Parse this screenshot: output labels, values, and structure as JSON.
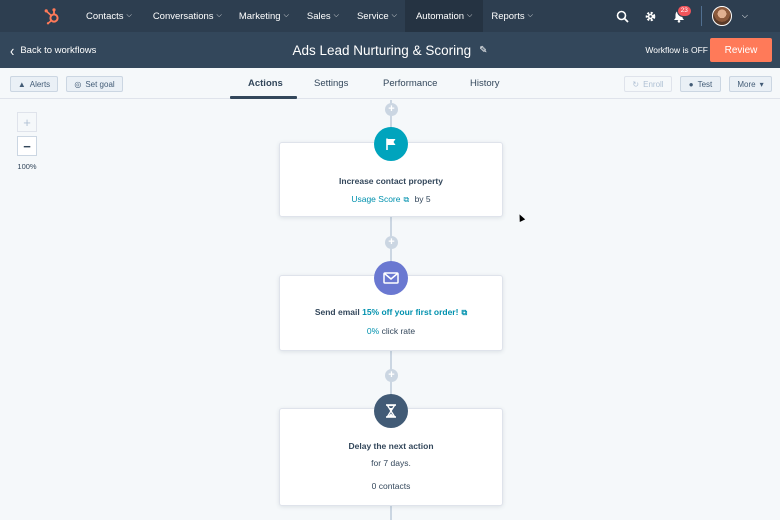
{
  "nav": {
    "items": [
      {
        "label": "Contacts"
      },
      {
        "label": "Conversations"
      },
      {
        "label": "Marketing"
      },
      {
        "label": "Sales"
      },
      {
        "label": "Service"
      },
      {
        "label": "Automation"
      },
      {
        "label": "Reports"
      }
    ],
    "notifications_count": "23",
    "icons": [
      "hubspot-logo",
      "search-icon",
      "gear-icon",
      "bell-icon",
      "avatar"
    ]
  },
  "header": {
    "back_label": "Back to workflows",
    "title": "Ads Lead Nurturing & Scoring",
    "status": "Workflow is OFF",
    "review_label": "Review"
  },
  "toolbar": {
    "alerts_label": "Alerts",
    "set_goal_label": "Set goal",
    "enroll_label": "Enroll",
    "test_label": "Test",
    "more_label": "More"
  },
  "tabs": [
    {
      "label": "Actions",
      "active": true
    },
    {
      "label": "Settings"
    },
    {
      "label": "Performance"
    },
    {
      "label": "History"
    }
  ],
  "zoom": {
    "plus": "+",
    "minus": "−",
    "level": "100%"
  },
  "steps": [
    {
      "icon": "flag-icon",
      "icon_color": "#00a4bd",
      "title": "Increase contact property",
      "property_link": "Usage Score",
      "by_text": "by 5"
    },
    {
      "icon": "envelope-icon",
      "icon_color": "#6a78d1",
      "title_prefix": "Send email",
      "email_link": "15% off your first order!",
      "rate_value": "0%",
      "rate_label": "click rate"
    },
    {
      "icon": "hourglass-icon",
      "icon_color": "#425b76",
      "title": "Delay the next action",
      "duration": "for 7 days.",
      "contacts": "0 contacts"
    }
  ],
  "colors": {
    "nav_bg": "#2d3e50",
    "header_bg": "#33475b",
    "accent": "#ff7a59",
    "link": "#0091ae"
  }
}
